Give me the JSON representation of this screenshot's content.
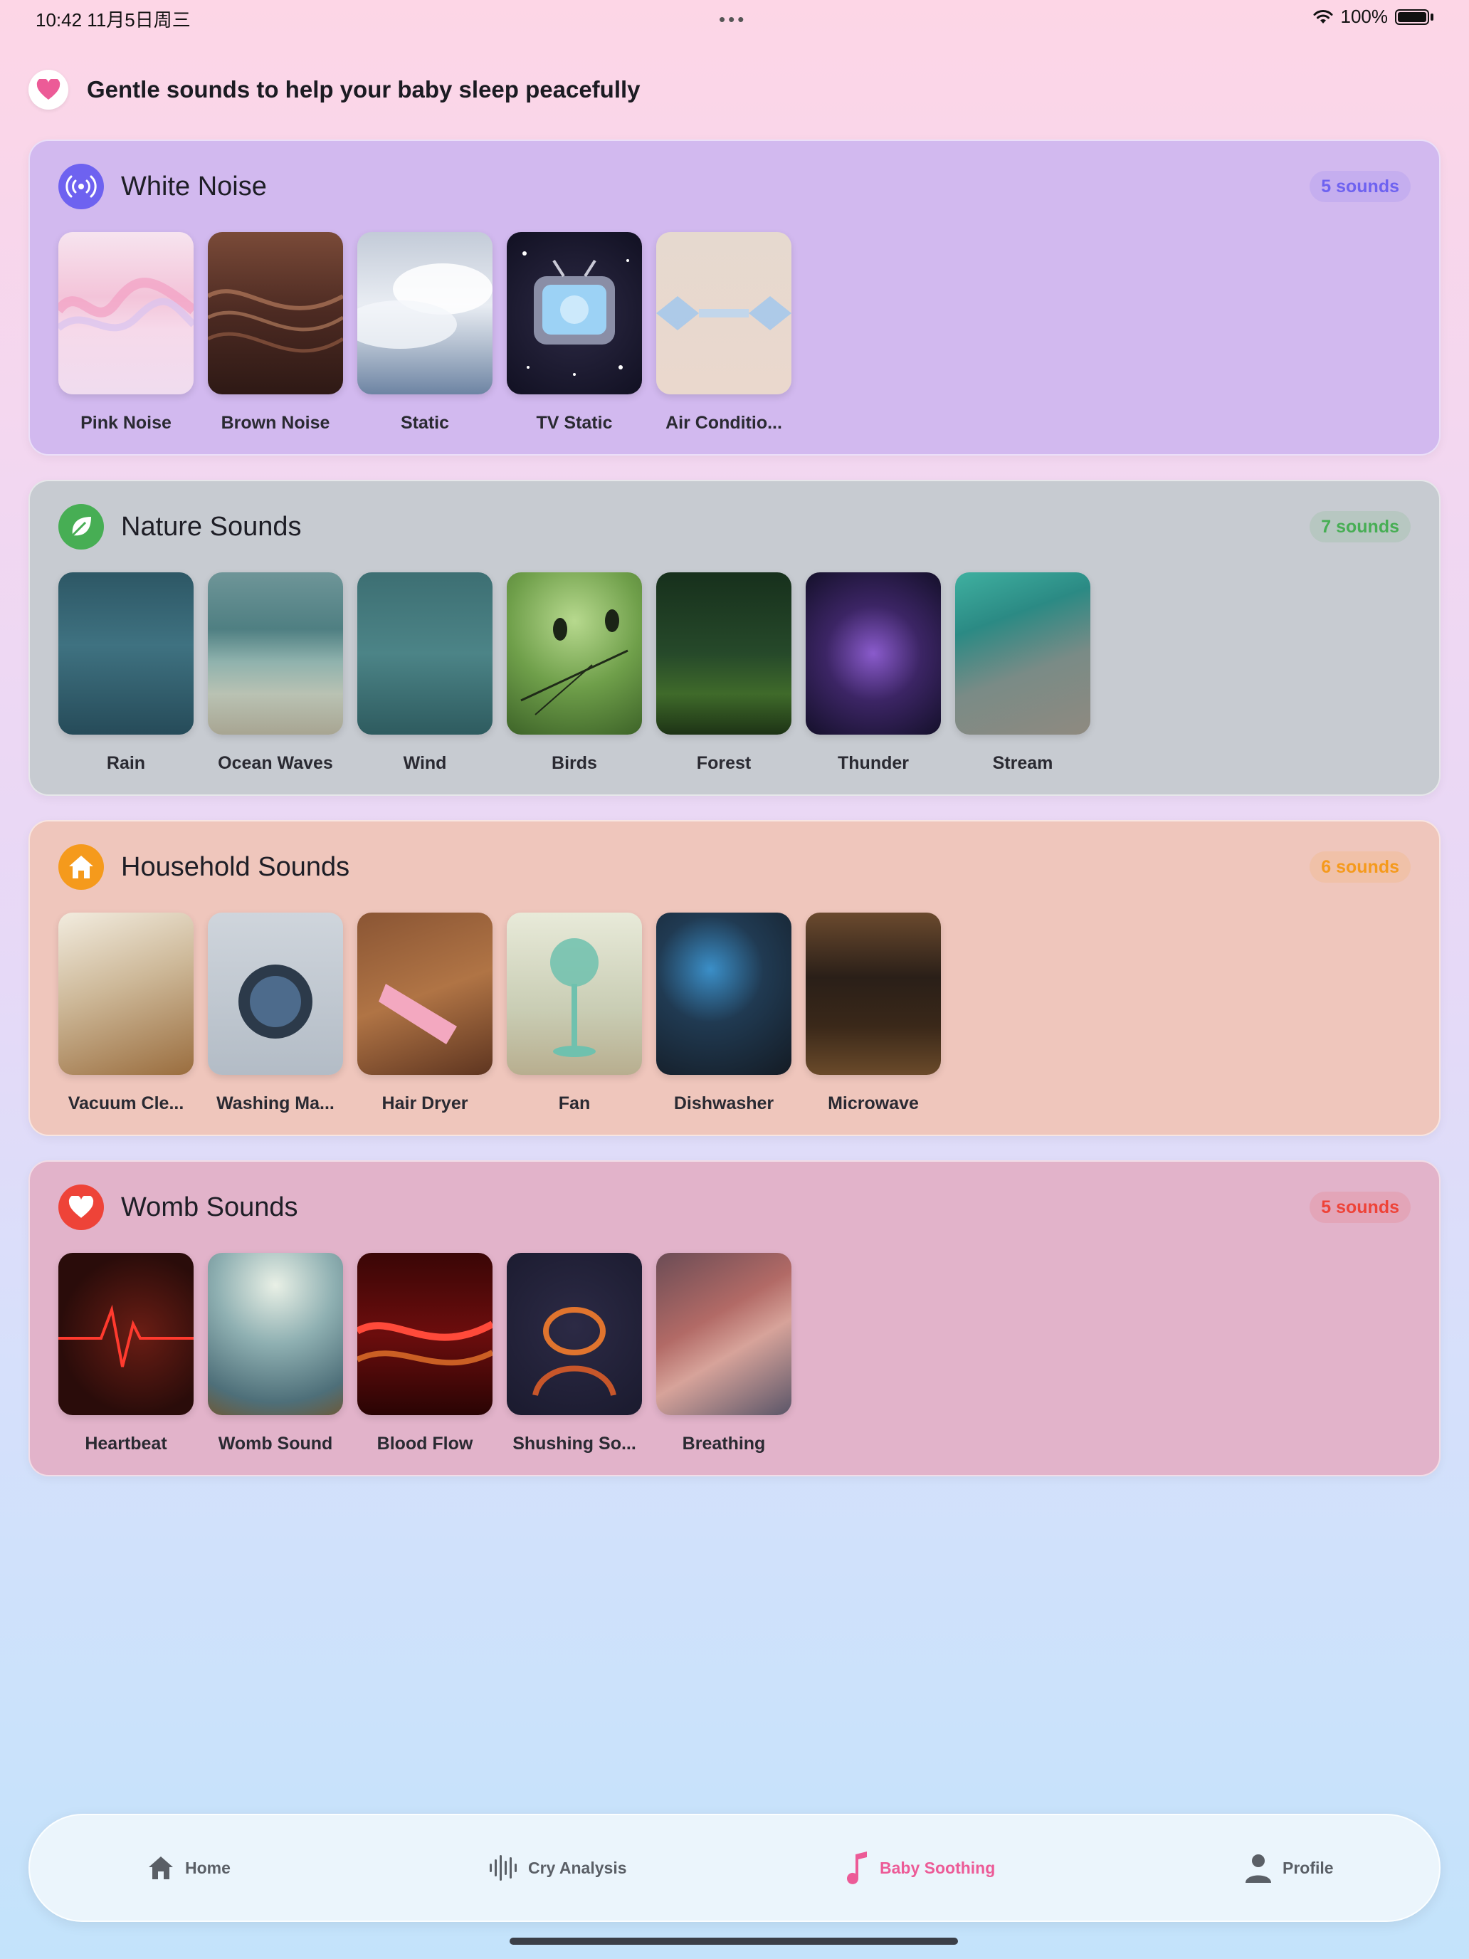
{
  "status_bar": {
    "time": "10:42 11月5日周三",
    "battery": "100%"
  },
  "header": {
    "title": "Gentle sounds to help your baby sleep peacefully"
  },
  "categories": [
    {
      "title": "White Noise",
      "count": "5 sounds",
      "icon": "broadcast-icon",
      "accent": "#6e62f0",
      "bg": "#d2b9ef",
      "sounds": [
        "Pink Noise",
        "Brown Noise",
        "Static",
        "TV Static",
        "Air Conditio..."
      ]
    },
    {
      "title": "Nature Sounds",
      "count": "7 sounds",
      "icon": "leaf-icon",
      "accent": "#47ae54",
      "bg": "#c7cbd1",
      "sounds": [
        "Rain",
        "Ocean Waves",
        "Wind",
        "Birds",
        "Forest",
        "Thunder",
        "Stream"
      ]
    },
    {
      "title": "Household Sounds",
      "count": "6 sounds",
      "icon": "house-icon",
      "accent": "#f59a1c",
      "bg": "#efc6bc",
      "sounds": [
        "Vacuum Cle...",
        "Washing Ma...",
        "Hair Dryer",
        "Fan",
        "Dishwasher",
        "Microwave"
      ]
    },
    {
      "title": "Womb Sounds",
      "count": "5 sounds",
      "icon": "heart-icon",
      "accent": "#ee4338",
      "bg": "#e2b3ca",
      "sounds": [
        "Heartbeat",
        "Womb Sound",
        "Blood Flow",
        "Shushing So...",
        "Breathing"
      ]
    }
  ],
  "tabs": [
    {
      "label": "Home",
      "icon": "home-icon",
      "active": false
    },
    {
      "label": "Cry Analysis",
      "icon": "waveform-icon",
      "active": false
    },
    {
      "label": "Baby Soothing",
      "icon": "music-note-icon",
      "active": true
    },
    {
      "label": "Profile",
      "icon": "person-icon",
      "active": false
    }
  ],
  "colors": {
    "active_tab": "#ec5b97",
    "inactive_tab": "#5a5f66"
  }
}
